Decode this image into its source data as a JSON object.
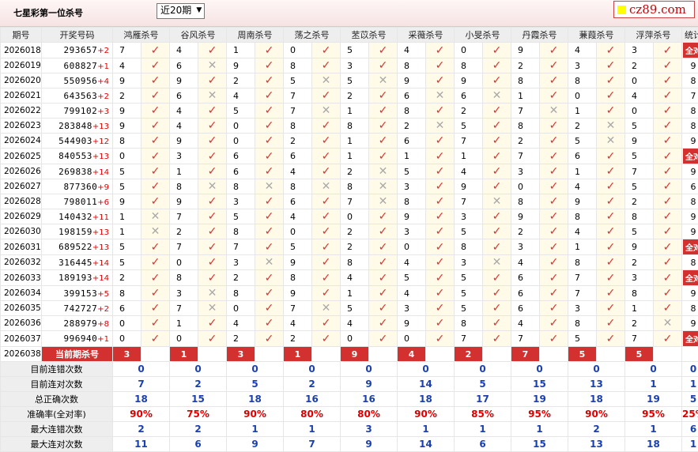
{
  "header": {
    "title": "七星彩第一位杀号",
    "period_select": "近20期",
    "brand": "cz89.com"
  },
  "columns": [
    "期号",
    "开奖号码",
    "鸿雁杀号",
    "谷风杀号",
    "周南杀号",
    "荡之杀号",
    "苤苡杀号",
    "采薇杀号",
    "小旻杀号",
    "丹霞杀号",
    "蒹葭杀号",
    "浮萍杀号",
    "统计"
  ],
  "all_right_label": "全对",
  "rows": [
    {
      "period": "2026018",
      "num": "293657",
      "sfx": "+2",
      "kills": [
        [
          "7",
          1
        ],
        [
          "4",
          1
        ],
        [
          "1",
          1
        ],
        [
          "0",
          1
        ],
        [
          "5",
          1
        ],
        [
          "4",
          1
        ],
        [
          "0",
          1
        ],
        [
          "9",
          1
        ],
        [
          "4",
          1
        ],
        [
          "3",
          1
        ]
      ],
      "stat": "全对"
    },
    {
      "period": "2026019",
      "num": "608827",
      "sfx": "+1",
      "kills": [
        [
          "4",
          1
        ],
        [
          "6",
          0
        ],
        [
          "9",
          1
        ],
        [
          "8",
          1
        ],
        [
          "3",
          1
        ],
        [
          "8",
          1
        ],
        [
          "8",
          1
        ],
        [
          "2",
          1
        ],
        [
          "3",
          1
        ],
        [
          "2",
          1
        ]
      ],
      "stat": "9"
    },
    {
      "period": "2026020",
      "num": "550956",
      "sfx": "+4",
      "kills": [
        [
          "9",
          1
        ],
        [
          "9",
          1
        ],
        [
          "2",
          1
        ],
        [
          "5",
          0
        ],
        [
          "5",
          0
        ],
        [
          "9",
          1
        ],
        [
          "9",
          1
        ],
        [
          "8",
          1
        ],
        [
          "8",
          1
        ],
        [
          "0",
          1
        ]
      ],
      "stat": "8"
    },
    {
      "period": "2026021",
      "num": "643563",
      "sfx": "+2",
      "kills": [
        [
          "2",
          1
        ],
        [
          "6",
          0
        ],
        [
          "4",
          1
        ],
        [
          "7",
          1
        ],
        [
          "2",
          1
        ],
        [
          "6",
          0
        ],
        [
          "6",
          0
        ],
        [
          "1",
          1
        ],
        [
          "0",
          1
        ],
        [
          "4",
          1
        ]
      ],
      "stat": "7"
    },
    {
      "period": "2026022",
      "num": "799102",
      "sfx": "+3",
      "kills": [
        [
          "9",
          1
        ],
        [
          "4",
          1
        ],
        [
          "5",
          1
        ],
        [
          "7",
          0
        ],
        [
          "1",
          1
        ],
        [
          "8",
          1
        ],
        [
          "2",
          1
        ],
        [
          "7",
          0
        ],
        [
          "1",
          1
        ],
        [
          "0",
          1
        ]
      ],
      "stat": "8"
    },
    {
      "period": "2026023",
      "num": "283848",
      "sfx": "+13",
      "kills": [
        [
          "9",
          1
        ],
        [
          "4",
          1
        ],
        [
          "0",
          1
        ],
        [
          "8",
          1
        ],
        [
          "8",
          1
        ],
        [
          "2",
          0
        ],
        [
          "5",
          1
        ],
        [
          "8",
          1
        ],
        [
          "2",
          0
        ],
        [
          "5",
          1
        ]
      ],
      "stat": "8"
    },
    {
      "period": "2026024",
      "num": "544903",
      "sfx": "+12",
      "kills": [
        [
          "8",
          1
        ],
        [
          "9",
          1
        ],
        [
          "0",
          1
        ],
        [
          "2",
          1
        ],
        [
          "1",
          1
        ],
        [
          "6",
          1
        ],
        [
          "7",
          1
        ],
        [
          "2",
          1
        ],
        [
          "5",
          0
        ],
        [
          "9",
          1
        ]
      ],
      "stat": "9"
    },
    {
      "period": "2026025",
      "num": "840553",
      "sfx": "+13",
      "kills": [
        [
          "0",
          1
        ],
        [
          "3",
          1
        ],
        [
          "6",
          1
        ],
        [
          "6",
          1
        ],
        [
          "1",
          1
        ],
        [
          "1",
          1
        ],
        [
          "1",
          1
        ],
        [
          "7",
          1
        ],
        [
          "6",
          1
        ],
        [
          "5",
          1
        ]
      ],
      "stat": "全对"
    },
    {
      "period": "2026026",
      "num": "269838",
      "sfx": "+14",
      "kills": [
        [
          "5",
          1
        ],
        [
          "1",
          1
        ],
        [
          "6",
          1
        ],
        [
          "4",
          1
        ],
        [
          "2",
          0
        ],
        [
          "5",
          1
        ],
        [
          "4",
          1
        ],
        [
          "3",
          1
        ],
        [
          "1",
          1
        ],
        [
          "7",
          1
        ]
      ],
      "stat": "9"
    },
    {
      "period": "2026027",
      "num": "877360",
      "sfx": "+9",
      "kills": [
        [
          "5",
          1
        ],
        [
          "8",
          0
        ],
        [
          "8",
          0
        ],
        [
          "8",
          0
        ],
        [
          "8",
          0
        ],
        [
          "3",
          1
        ],
        [
          "9",
          1
        ],
        [
          "0",
          1
        ],
        [
          "4",
          1
        ],
        [
          "5",
          1
        ]
      ],
      "stat": "6"
    },
    {
      "period": "2026028",
      "num": "798011",
      "sfx": "+6",
      "kills": [
        [
          "9",
          1
        ],
        [
          "9",
          1
        ],
        [
          "3",
          1
        ],
        [
          "6",
          1
        ],
        [
          "7",
          0
        ],
        [
          "8",
          1
        ],
        [
          "7",
          0
        ],
        [
          "8",
          1
        ],
        [
          "9",
          1
        ],
        [
          "2",
          1
        ]
      ],
      "stat": "8"
    },
    {
      "period": "2026029",
      "num": "140432",
      "sfx": "+11",
      "kills": [
        [
          "1",
          0
        ],
        [
          "7",
          1
        ],
        [
          "5",
          1
        ],
        [
          "4",
          1
        ],
        [
          "0",
          1
        ],
        [
          "9",
          1
        ],
        [
          "3",
          1
        ],
        [
          "9",
          1
        ],
        [
          "8",
          1
        ],
        [
          "8",
          1
        ]
      ],
      "stat": "9"
    },
    {
      "period": "2026030",
      "num": "198159",
      "sfx": "+13",
      "kills": [
        [
          "1",
          0
        ],
        [
          "2",
          1
        ],
        [
          "8",
          1
        ],
        [
          "0",
          1
        ],
        [
          "2",
          1
        ],
        [
          "3",
          1
        ],
        [
          "5",
          1
        ],
        [
          "2",
          1
        ],
        [
          "4",
          1
        ],
        [
          "5",
          1
        ]
      ],
      "stat": "9"
    },
    {
      "period": "2026031",
      "num": "689522",
      "sfx": "+13",
      "kills": [
        [
          "5",
          1
        ],
        [
          "7",
          1
        ],
        [
          "7",
          1
        ],
        [
          "5",
          1
        ],
        [
          "2",
          1
        ],
        [
          "0",
          1
        ],
        [
          "8",
          1
        ],
        [
          "3",
          1
        ],
        [
          "1",
          1
        ],
        [
          "9",
          1
        ]
      ],
      "stat": "全对"
    },
    {
      "period": "2026032",
      "num": "316445",
      "sfx": "+14",
      "kills": [
        [
          "5",
          1
        ],
        [
          "0",
          1
        ],
        [
          "3",
          0
        ],
        [
          "9",
          1
        ],
        [
          "8",
          1
        ],
        [
          "4",
          1
        ],
        [
          "3",
          0
        ],
        [
          "4",
          1
        ],
        [
          "8",
          1
        ],
        [
          "2",
          1
        ]
      ],
      "stat": "8"
    },
    {
      "period": "2026033",
      "num": "189193",
      "sfx": "+14",
      "kills": [
        [
          "2",
          1
        ],
        [
          "8",
          1
        ],
        [
          "2",
          1
        ],
        [
          "8",
          1
        ],
        [
          "4",
          1
        ],
        [
          "5",
          1
        ],
        [
          "5",
          1
        ],
        [
          "6",
          1
        ],
        [
          "7",
          1
        ],
        [
          "3",
          1
        ]
      ],
      "stat": "全对"
    },
    {
      "period": "2026034",
      "num": "399153",
      "sfx": "+5",
      "kills": [
        [
          "8",
          1
        ],
        [
          "3",
          0
        ],
        [
          "8",
          1
        ],
        [
          "9",
          1
        ],
        [
          "1",
          1
        ],
        [
          "4",
          1
        ],
        [
          "5",
          1
        ],
        [
          "6",
          1
        ],
        [
          "7",
          1
        ],
        [
          "8",
          1
        ]
      ],
      "stat": "9"
    },
    {
      "period": "2026035",
      "num": "742727",
      "sfx": "+2",
      "kills": [
        [
          "6",
          1
        ],
        [
          "7",
          0
        ],
        [
          "0",
          1
        ],
        [
          "7",
          0
        ],
        [
          "5",
          1
        ],
        [
          "3",
          1
        ],
        [
          "5",
          1
        ],
        [
          "6",
          1
        ],
        [
          "3",
          1
        ],
        [
          "1",
          1
        ]
      ],
      "stat": "8"
    },
    {
      "period": "2026036",
      "num": "288979",
      "sfx": "+8",
      "kills": [
        [
          "0",
          1
        ],
        [
          "1",
          1
        ],
        [
          "4",
          1
        ],
        [
          "4",
          1
        ],
        [
          "4",
          1
        ],
        [
          "9",
          1
        ],
        [
          "8",
          1
        ],
        [
          "4",
          1
        ],
        [
          "8",
          1
        ],
        [
          "2",
          0
        ]
      ],
      "stat": "9"
    },
    {
      "period": "2026037",
      "num": "996940",
      "sfx": "+1",
      "kills": [
        [
          "0",
          1
        ],
        [
          "0",
          1
        ],
        [
          "2",
          1
        ],
        [
          "2",
          1
        ],
        [
          "0",
          1
        ],
        [
          "0",
          1
        ],
        [
          "7",
          1
        ],
        [
          "7",
          1
        ],
        [
          "5",
          1
        ],
        [
          "7",
          1
        ]
      ],
      "stat": "全对"
    }
  ],
  "current": {
    "period": "2026038",
    "label": "当前期杀号",
    "kills": [
      "3",
      "1",
      "3",
      "1",
      "9",
      "4",
      "2",
      "7",
      "5",
      "5"
    ]
  },
  "summary": [
    {
      "label": "目前连错次数",
      "values": [
        "0",
        "0",
        "0",
        "0",
        "0",
        "0",
        "0",
        "0",
        "0",
        "0",
        "0"
      ],
      "red": false
    },
    {
      "label": "目前连对次数",
      "values": [
        "7",
        "2",
        "5",
        "2",
        "9",
        "14",
        "5",
        "15",
        "13",
        "1",
        "1"
      ],
      "red": false
    },
    {
      "label": "总正确次数",
      "values": [
        "18",
        "15",
        "18",
        "16",
        "16",
        "18",
        "17",
        "19",
        "18",
        "19",
        "5"
      ],
      "red": false
    },
    {
      "label": "准确率(全对率)",
      "values": [
        "90%",
        "75%",
        "90%",
        "80%",
        "80%",
        "90%",
        "85%",
        "95%",
        "90%",
        "95%",
        "25%"
      ],
      "red": true
    },
    {
      "label": "最大连错次数",
      "values": [
        "2",
        "2",
        "1",
        "1",
        "3",
        "1",
        "1",
        "1",
        "2",
        "1",
        "6"
      ],
      "red": false
    },
    {
      "label": "最大连对次数",
      "values": [
        "11",
        "6",
        "9",
        "7",
        "9",
        "14",
        "6",
        "15",
        "13",
        "18",
        "1"
      ],
      "red": false
    }
  ],
  "colors": {
    "accent": "#d3312f",
    "check": "#e0302f",
    "cross": "#a9a9a9",
    "summary_blue": "#1a3fb0"
  },
  "icons": {
    "ok": "check-mark-icon",
    "no": "cross-mark-icon"
  }
}
